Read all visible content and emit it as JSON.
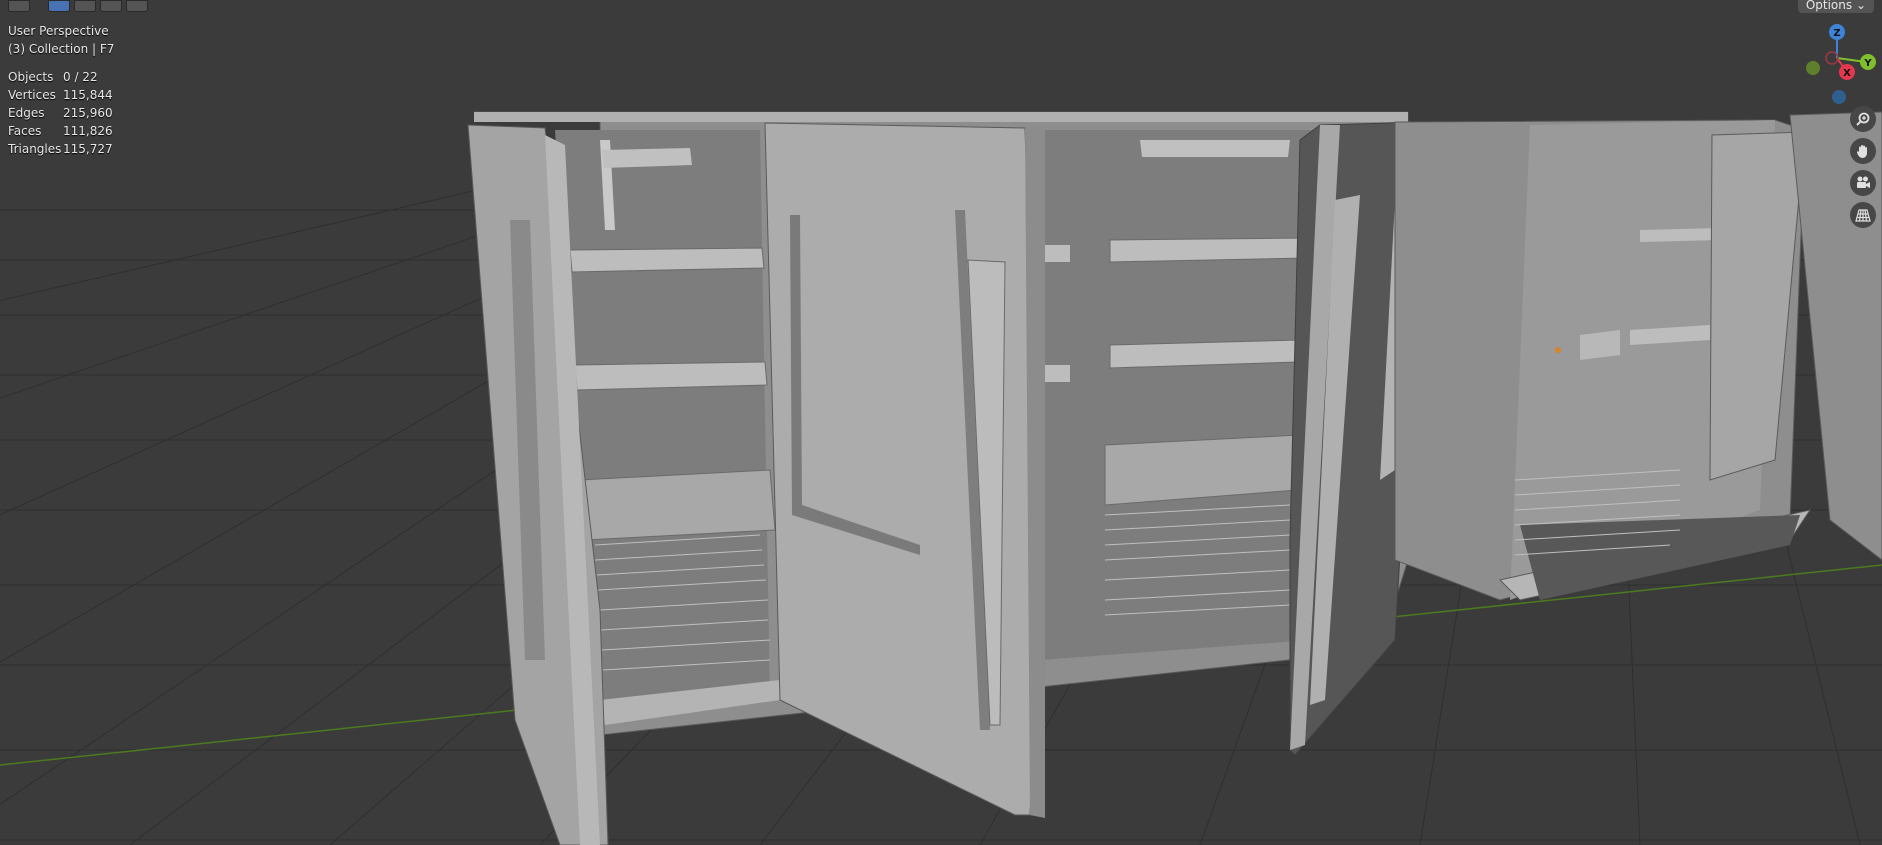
{
  "viewport": {
    "view_name": "User Perspective",
    "collection": "(3) Collection | F7",
    "options_label": "Options"
  },
  "stats": [
    {
      "label": "Objects",
      "value": "0 / 22"
    },
    {
      "label": "Vertices",
      "value": "115,844"
    },
    {
      "label": "Edges",
      "value": "215,960"
    },
    {
      "label": "Faces",
      "value": "111,826"
    },
    {
      "label": "Triangles",
      "value": "115,727"
    }
  ],
  "gizmo": {
    "z": "Z",
    "y": "Y",
    "x": "X"
  },
  "colors": {
    "background": "#3b3b3b",
    "grid": "#2f2f2f",
    "x_axis": "#4d7a1e",
    "model": "#9a9a9a",
    "gizmo_x": "#e3384e",
    "gizmo_y": "#7fbf2c",
    "gizmo_z": "#3d84d9"
  },
  "nav_tools": [
    "zoom-icon",
    "hand-icon",
    "camera-icon",
    "grid-icon"
  ]
}
